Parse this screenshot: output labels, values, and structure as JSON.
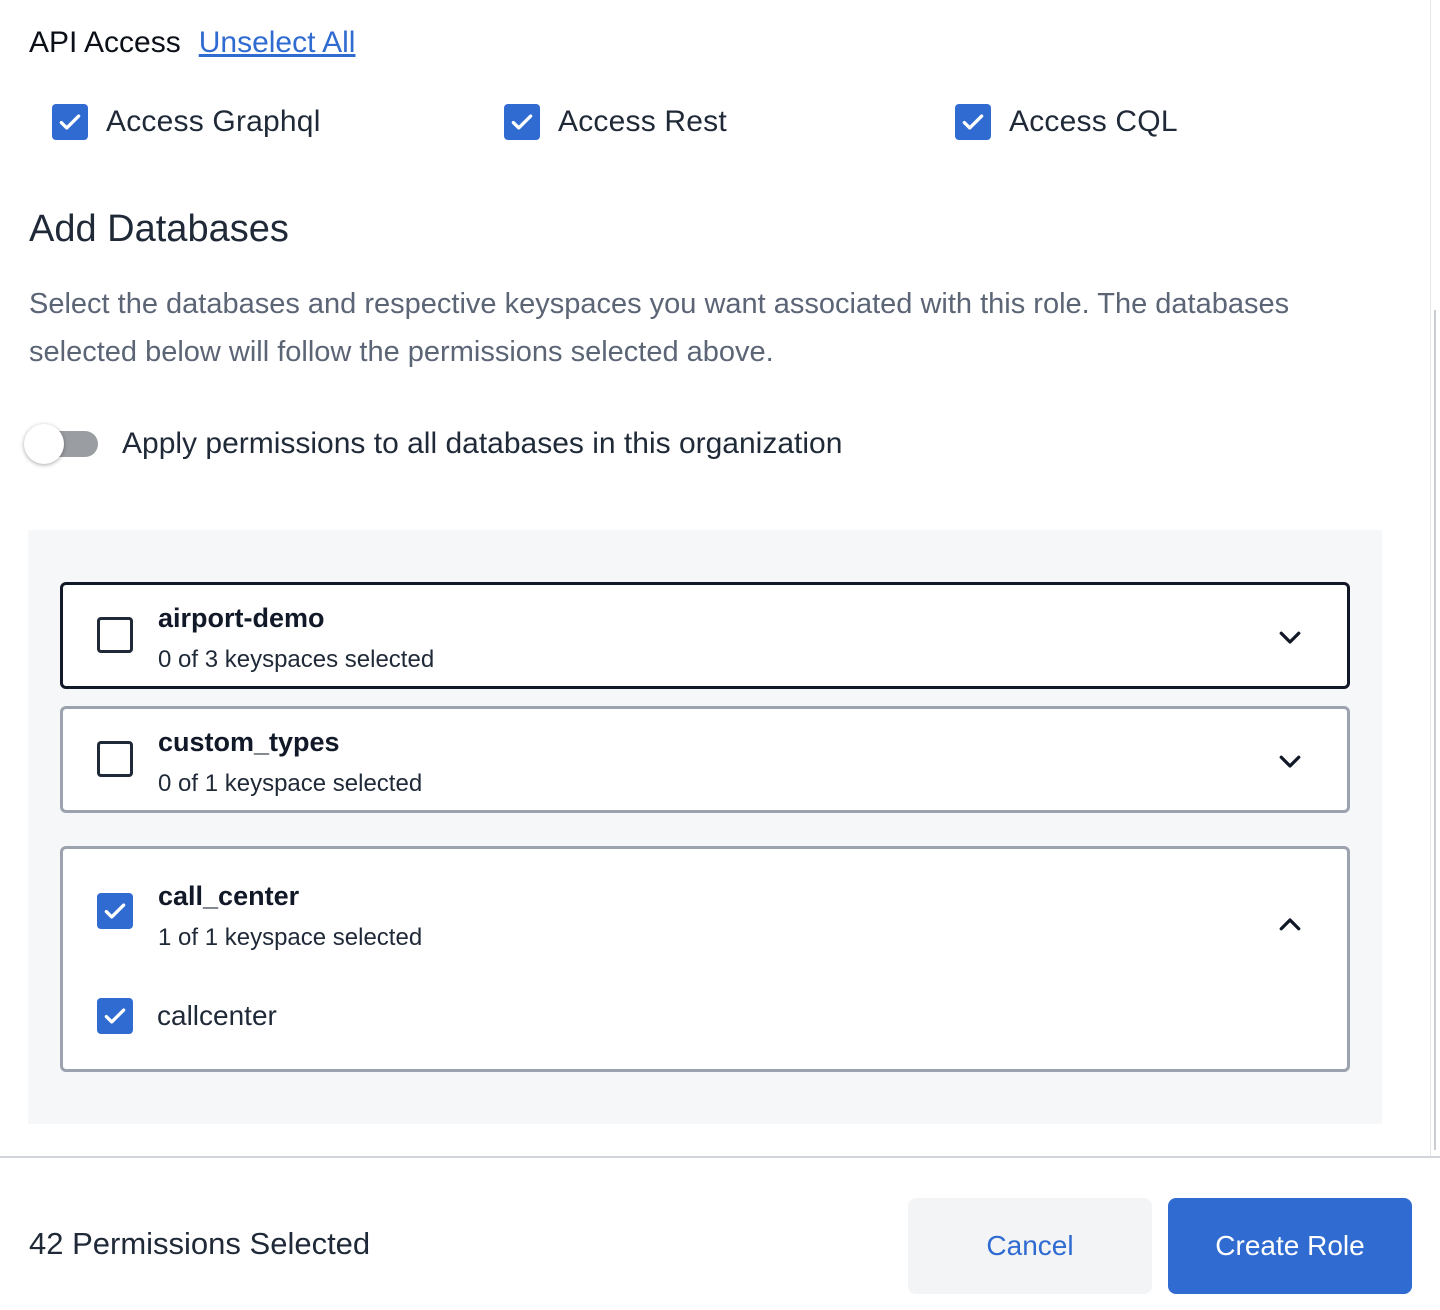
{
  "api_access": {
    "title": "API Access",
    "unselect_all": "Unselect All",
    "options": [
      {
        "label": "Access Graphql",
        "checked": true
      },
      {
        "label": "Access Rest",
        "checked": true
      },
      {
        "label": "Access CQL",
        "checked": true
      }
    ]
  },
  "databases": {
    "title": "Add Databases",
    "description": "Select the databases and respective keyspaces you want associated with this role. The databases selected below will follow the permissions selected above.",
    "apply_all_label": "Apply permissions to all databases in this organization",
    "apply_all_enabled": false,
    "items": [
      {
        "name": "airport-demo",
        "summary": "0 of 3 keyspaces selected",
        "checked": false,
        "expanded": false
      },
      {
        "name": "custom_types",
        "summary": "0 of 1 keyspace selected",
        "checked": false,
        "expanded": false
      },
      {
        "name": "call_center",
        "summary": "1 of 1 keyspace selected",
        "checked": true,
        "expanded": true,
        "keyspaces": [
          {
            "label": "callcenter",
            "checked": true
          }
        ]
      }
    ]
  },
  "footer": {
    "permissions_count": "42 Permissions Selected",
    "cancel_label": "Cancel",
    "create_label": "Create Role"
  },
  "colors": {
    "accent": "#2f6bd1",
    "panel_bg": "#f6f7f9",
    "muted_text": "#5b6576"
  },
  "icons": {
    "check": "check-icon",
    "expand": "chevron-down-icon",
    "collapse": "chevron-up-icon"
  }
}
